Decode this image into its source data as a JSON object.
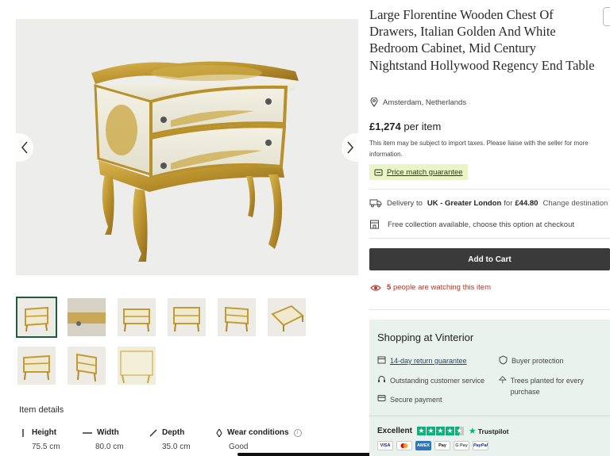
{
  "product": {
    "title": "Large Florentine Wooden Chest Of Drawers, Italian Golden And White Bedroom Cabinet, Mid Century Nightstand Hollywood Regency End Table",
    "location": "Amsterdam, Netherlands",
    "price": "£1,274",
    "price_unit": "per item",
    "tax_note": "This item may be subject to import taxes. Please liaise with the seller for more information.",
    "price_match": "Price match guarantee"
  },
  "delivery": {
    "prefix": "Delivery to",
    "region": "UK - Greater London",
    "for": "for",
    "cost": "£44.80",
    "change": "Change destination",
    "collection": "Free collection available, choose this option at checkout"
  },
  "cart": {
    "button": "Add to Cart"
  },
  "watching": {
    "count": "5",
    "text": "people are watching this item"
  },
  "shop": {
    "title": "Shopping at Vinterior",
    "return": "14-day return guarantee",
    "buyer_protection": "Buyer protection",
    "customer_service": "Outstanding customer service",
    "trees": "Trees planted for every purchase",
    "secure": "Secure payment",
    "rating_label": "Excellent",
    "rating_stars": 4.5,
    "trustpilot": "Trustpilot",
    "payments": [
      "VISA",
      "MC",
      "AMEX",
      "Pay",
      "G Pay",
      "PayPal"
    ]
  },
  "details": {
    "title": "Item details",
    "height_label": "Height",
    "height_value": "75.5 cm",
    "width_label": "Width",
    "width_value": "80.0 cm",
    "depth_label": "Depth",
    "depth_value": "35.0 cm",
    "wear_label": "Wear conditions",
    "wear_value": "Good"
  },
  "gallery": {
    "image_count": 9,
    "active_index": 0
  },
  "colors": {
    "accent": "#1f5a3e",
    "cart": "#3a3a3a",
    "watch": "#b03a2e",
    "price_match_bg": "#e9f5c6",
    "shop_bg": "#eaf2ee",
    "trustpilot": "#00b67a"
  }
}
